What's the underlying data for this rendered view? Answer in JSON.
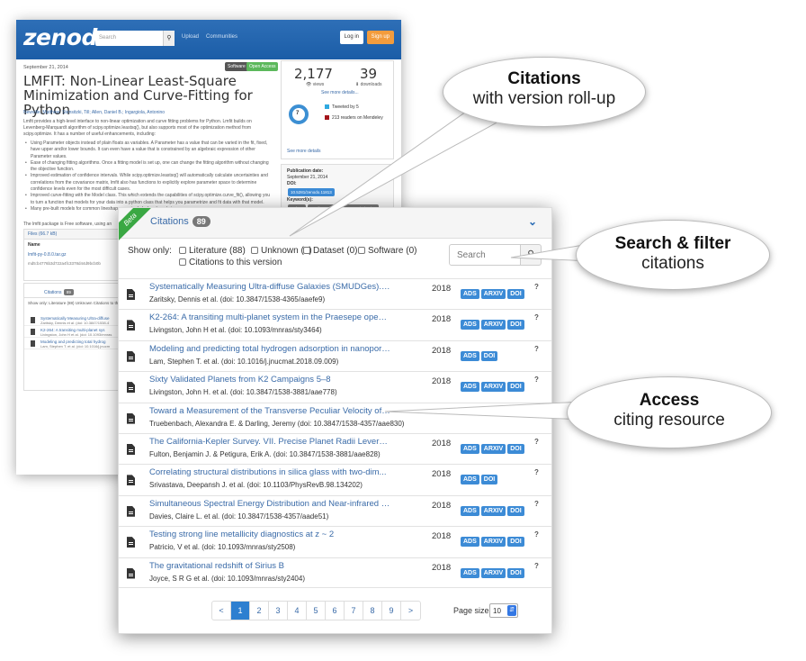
{
  "background_page": {
    "logo": "zenodo",
    "search_placeholder": "Search",
    "nav": [
      "Upload",
      "Communities"
    ],
    "login": "Log in",
    "signup": "Sign up",
    "date": "September 21, 2014",
    "badges": [
      "Software",
      "Open Access"
    ],
    "title": "LMFIT: Non-Linear Least-Square Minimization and Curve-Fitting for Python",
    "authors": "Newville, Matthew; Stensitzki, Till; Allen, Daniel B.; Ingargiola, Antonino",
    "abstract": "Lmfit provides a high-level interface to non-linear optimization and curve fitting problems for Python. Lmfit builds on Levenberg-Marquardt algorithm of scipy.optimize.leastsq(), but also supports most of the optimization method from scipy.optimize. It has a number of useful enhancements, including:",
    "bullets": [
      "Using Parameter objects instead of plain floats as variables. A Parameter has a value that can be varied in the fit, fixed, have upper and/or lower bounds. It can even have a value that is constrained by an algebraic expression of other Parameter values.",
      "Ease of changing fitting algorithms. Once a fitting model is set up, one can change the fitting algorithm without changing the objective function.",
      "Improved estimation of confidence intervals. While scipy.optimize.leastsq() will automatically calculate uncertainties and correlations from the covariance matrix, lmfit also has functions to explicitly explore parameter space to determine confidence levels even for the most difficult cases.",
      "Improved curve-fitting with the Model class. This which extends the capabilities of scipy.optimize.curve_fit(), allowing you to turn a function that models for your data into a python class that helps you parametrize and fit data with that model.",
      "Many pre-built models for common lineshapes are included and ready to use."
    ],
    "package_note": "The lmfit package is Free software, using an",
    "views_count": "2,177",
    "views_label": "views",
    "downloads_count": "39",
    "downloads_label": "downloads",
    "see_more_details": "See more details...",
    "altmetric_score": "7",
    "tweeted": "Tweeted by 5",
    "mendeley": "213 readers on Mendeley",
    "see_more_details_2": "See more details",
    "pub_date_label": "Publication date:",
    "pub_date": "September 21, 2014",
    "doi_label": "DOI:",
    "doi": "10.5281/zenodo.11813",
    "keywords_label": "Keyword(s):",
    "keywords": [
      "python",
      "non-linear least-squares optimization",
      "curve-fitting"
    ],
    "files_header": "Files (66.7 kB)",
    "files_name_label": "Name",
    "file_name": "lmfit-py-0.8.0.tar.gz",
    "file_md5": "md5:b4776b3d722a4fc3378d44d9bcb0b",
    "citations_label": "Citations",
    "citations_count": "89",
    "show_only_small": "Show only:  Literature (88)  Unknown  Citations to this version",
    "cit_rows": [
      {
        "title": "Systematically Measuring Ultra-diffuse",
        "meta": "Zaritsky, Dennis et al. (doi: 10.3847/1538-4"
      },
      {
        "title": "K2-264: A transiting multi-planet sys",
        "meta": "Livingston, John H et al. (doi: 10.1093/mnras"
      },
      {
        "title": "Modeling and predicting total hydrog",
        "meta": "Lam, Stephen T. et al. (doi: 10.1016/j.jnucm"
      }
    ]
  },
  "widget": {
    "beta_label": "Beta",
    "title": "Citations",
    "count": "89",
    "show_only_label": "Show only:",
    "filters": [
      "Literature (88)",
      "Unknown (1)",
      "Dataset (0)",
      "Software (0)",
      "Citations to this version"
    ],
    "search_placeholder": "Search",
    "rows": [
      {
        "title": "Systematically Measuring Ultra-diffuse Galaxies (SMUDGes). I. Sur...",
        "authors": "Zaritsky, Dennis et al.",
        "doi": "(doi: 10.3847/1538-4365/aaefe9)",
        "year": "2018",
        "links": [
          "ADS",
          "ARXIV",
          "DOI"
        ]
      },
      {
        "title": "K2-264: A transiting multi-planet system in the Praesepe open clu...",
        "authors": "Livingston, John H et al.",
        "doi": "(doi: 10.1093/mnras/sty3464)",
        "year": "2018",
        "links": [
          "ADS",
          "ARXIV",
          "DOI"
        ]
      },
      {
        "title": "Modeling and predicting total hydrogen adsorption in nanoporous c...",
        "authors": "Lam, Stephen T. et al.",
        "doi": "(doi: 10.1016/j.jnucmat.2018.09.009)",
        "year": "2018",
        "links": [
          "ADS",
          "DOI"
        ]
      },
      {
        "title": "Sixty Validated Planets from K2 Campaigns 5–8",
        "authors": "Livingston, John H. et al.",
        "doi": "(doi: 10.3847/1538-3881/aae778)",
        "year": "2018",
        "links": [
          "ADS",
          "ARXIV",
          "DOI"
        ]
      },
      {
        "title": "Toward a Measurement of the Transverse Peculiar Velocity of Galax...",
        "authors": "Truebenbach, Alexandra E. & Darling, Jeremy",
        "doi": "(doi: 10.3847/1538-4357/aae830)",
        "year": "",
        "links": []
      },
      {
        "title": "The California-Kepler Survey. VII. Precise Planet Radii Leveragin...",
        "authors": "Fulton, Benjamin J. & Petigura, Erik A.",
        "doi": "(doi: 10.3847/1538-3881/aae828)",
        "year": "2018",
        "links": [
          "ADS",
          "ARXIV",
          "DOI"
        ]
      },
      {
        "title": "Correlating structural distributions in silica glass with two-dim...",
        "authors": "Srivastava, Deepansh J. et al.",
        "doi": "(doi: 10.1103/PhysRevB.98.134202)",
        "year": "2018",
        "links": [
          "ADS",
          "DOI"
        ]
      },
      {
        "title": "Simultaneous Spectral Energy Distribution and Near-infrared Inter...",
        "authors": "Davies, Claire L. et al.",
        "doi": "(doi: 10.3847/1538-4357/aade51)",
        "year": "2018",
        "links": [
          "ADS",
          "ARXIV",
          "DOI"
        ]
      },
      {
        "title": "Testing strong line metallicity diagnostics at z ~ 2",
        "authors": "Patricio, V et al.",
        "doi": "(doi: 10.1093/mnras/sty2508)",
        "year": "2018",
        "links": [
          "ADS",
          "ARXIV",
          "DOI"
        ]
      },
      {
        "title": "The gravitational redshift of Sirius B",
        "authors": "Joyce, S R G et al.",
        "doi": "(doi: 10.1093/mnras/sty2404)",
        "year": "2018",
        "links": [
          "ADS",
          "ARXIV",
          "DOI"
        ]
      }
    ],
    "pagination": [
      "<",
      "1",
      "2",
      "3",
      "4",
      "5",
      "6",
      "7",
      "8",
      "9",
      ">"
    ],
    "active_page": "1",
    "page_size_label": "Page size:",
    "page_size": "10"
  },
  "callouts": {
    "citations": {
      "heading": "Citations",
      "sub": "with version roll-up"
    },
    "search": {
      "heading": "Search & filter",
      "sub": "citations"
    },
    "access": {
      "heading": "Access",
      "sub": "citing resource"
    }
  },
  "colors": {
    "zenodo_blue": "#1b5da7",
    "link": "#3a6ba8",
    "badge_blue": "#3c8bd6",
    "beta_green": "#3aa843",
    "signup_orange": "#f39c3d"
  }
}
